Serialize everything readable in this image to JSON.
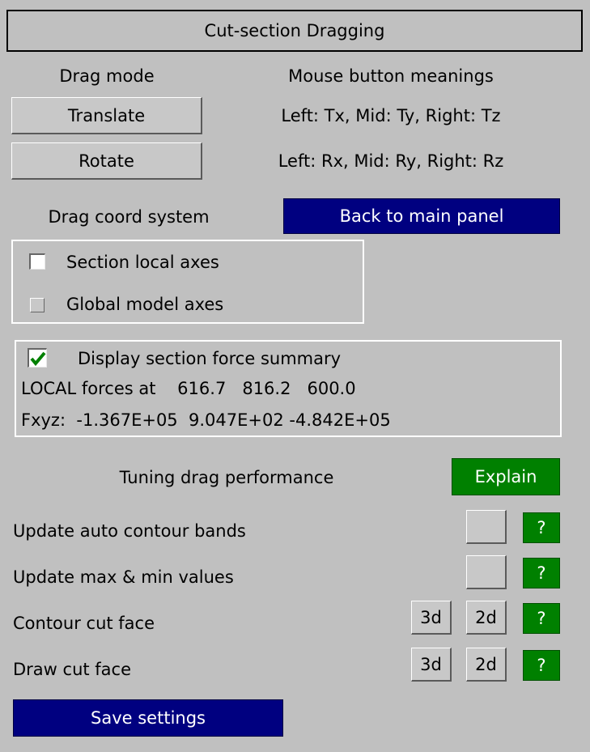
{
  "title": "Cut-section Dragging",
  "drag": {
    "mode_label": "Drag mode",
    "meanings_label": "Mouse button meanings",
    "translate_button": "Translate",
    "translate_meaning": "Left: Tx, Mid: Ty, Right: Tz",
    "rotate_button": "Rotate",
    "rotate_meaning": "Left: Rx, Mid: Ry, Right: Rz"
  },
  "coord": {
    "label": "Drag coord system",
    "back_button": "Back to main panel",
    "options": [
      {
        "label": "Section local axes",
        "selected": true
      },
      {
        "label": "Global model axes",
        "selected": false
      }
    ]
  },
  "summary": {
    "checkbox_label": "Display section force summary",
    "checked": true,
    "local_forces": "LOCAL forces at    616.7   816.2   600.0",
    "fxyz": "Fxyz:  -1.367E+05  9.047E+02 -4.842E+05"
  },
  "tuning": {
    "label": "Tuning drag performance",
    "explain_button": "Explain",
    "help_label": "?",
    "btn_3d": "3d",
    "btn_2d": "2d",
    "rows": [
      {
        "label": "Update auto contour bands"
      },
      {
        "label": "Update max & min values"
      },
      {
        "label": "Contour cut face"
      },
      {
        "label": "Draw cut face"
      }
    ]
  },
  "save_button": "Save settings",
  "colors": {
    "panel_bg": "#c0c0c0",
    "navy": "#000080",
    "green": "#008000",
    "check": "#008000"
  }
}
